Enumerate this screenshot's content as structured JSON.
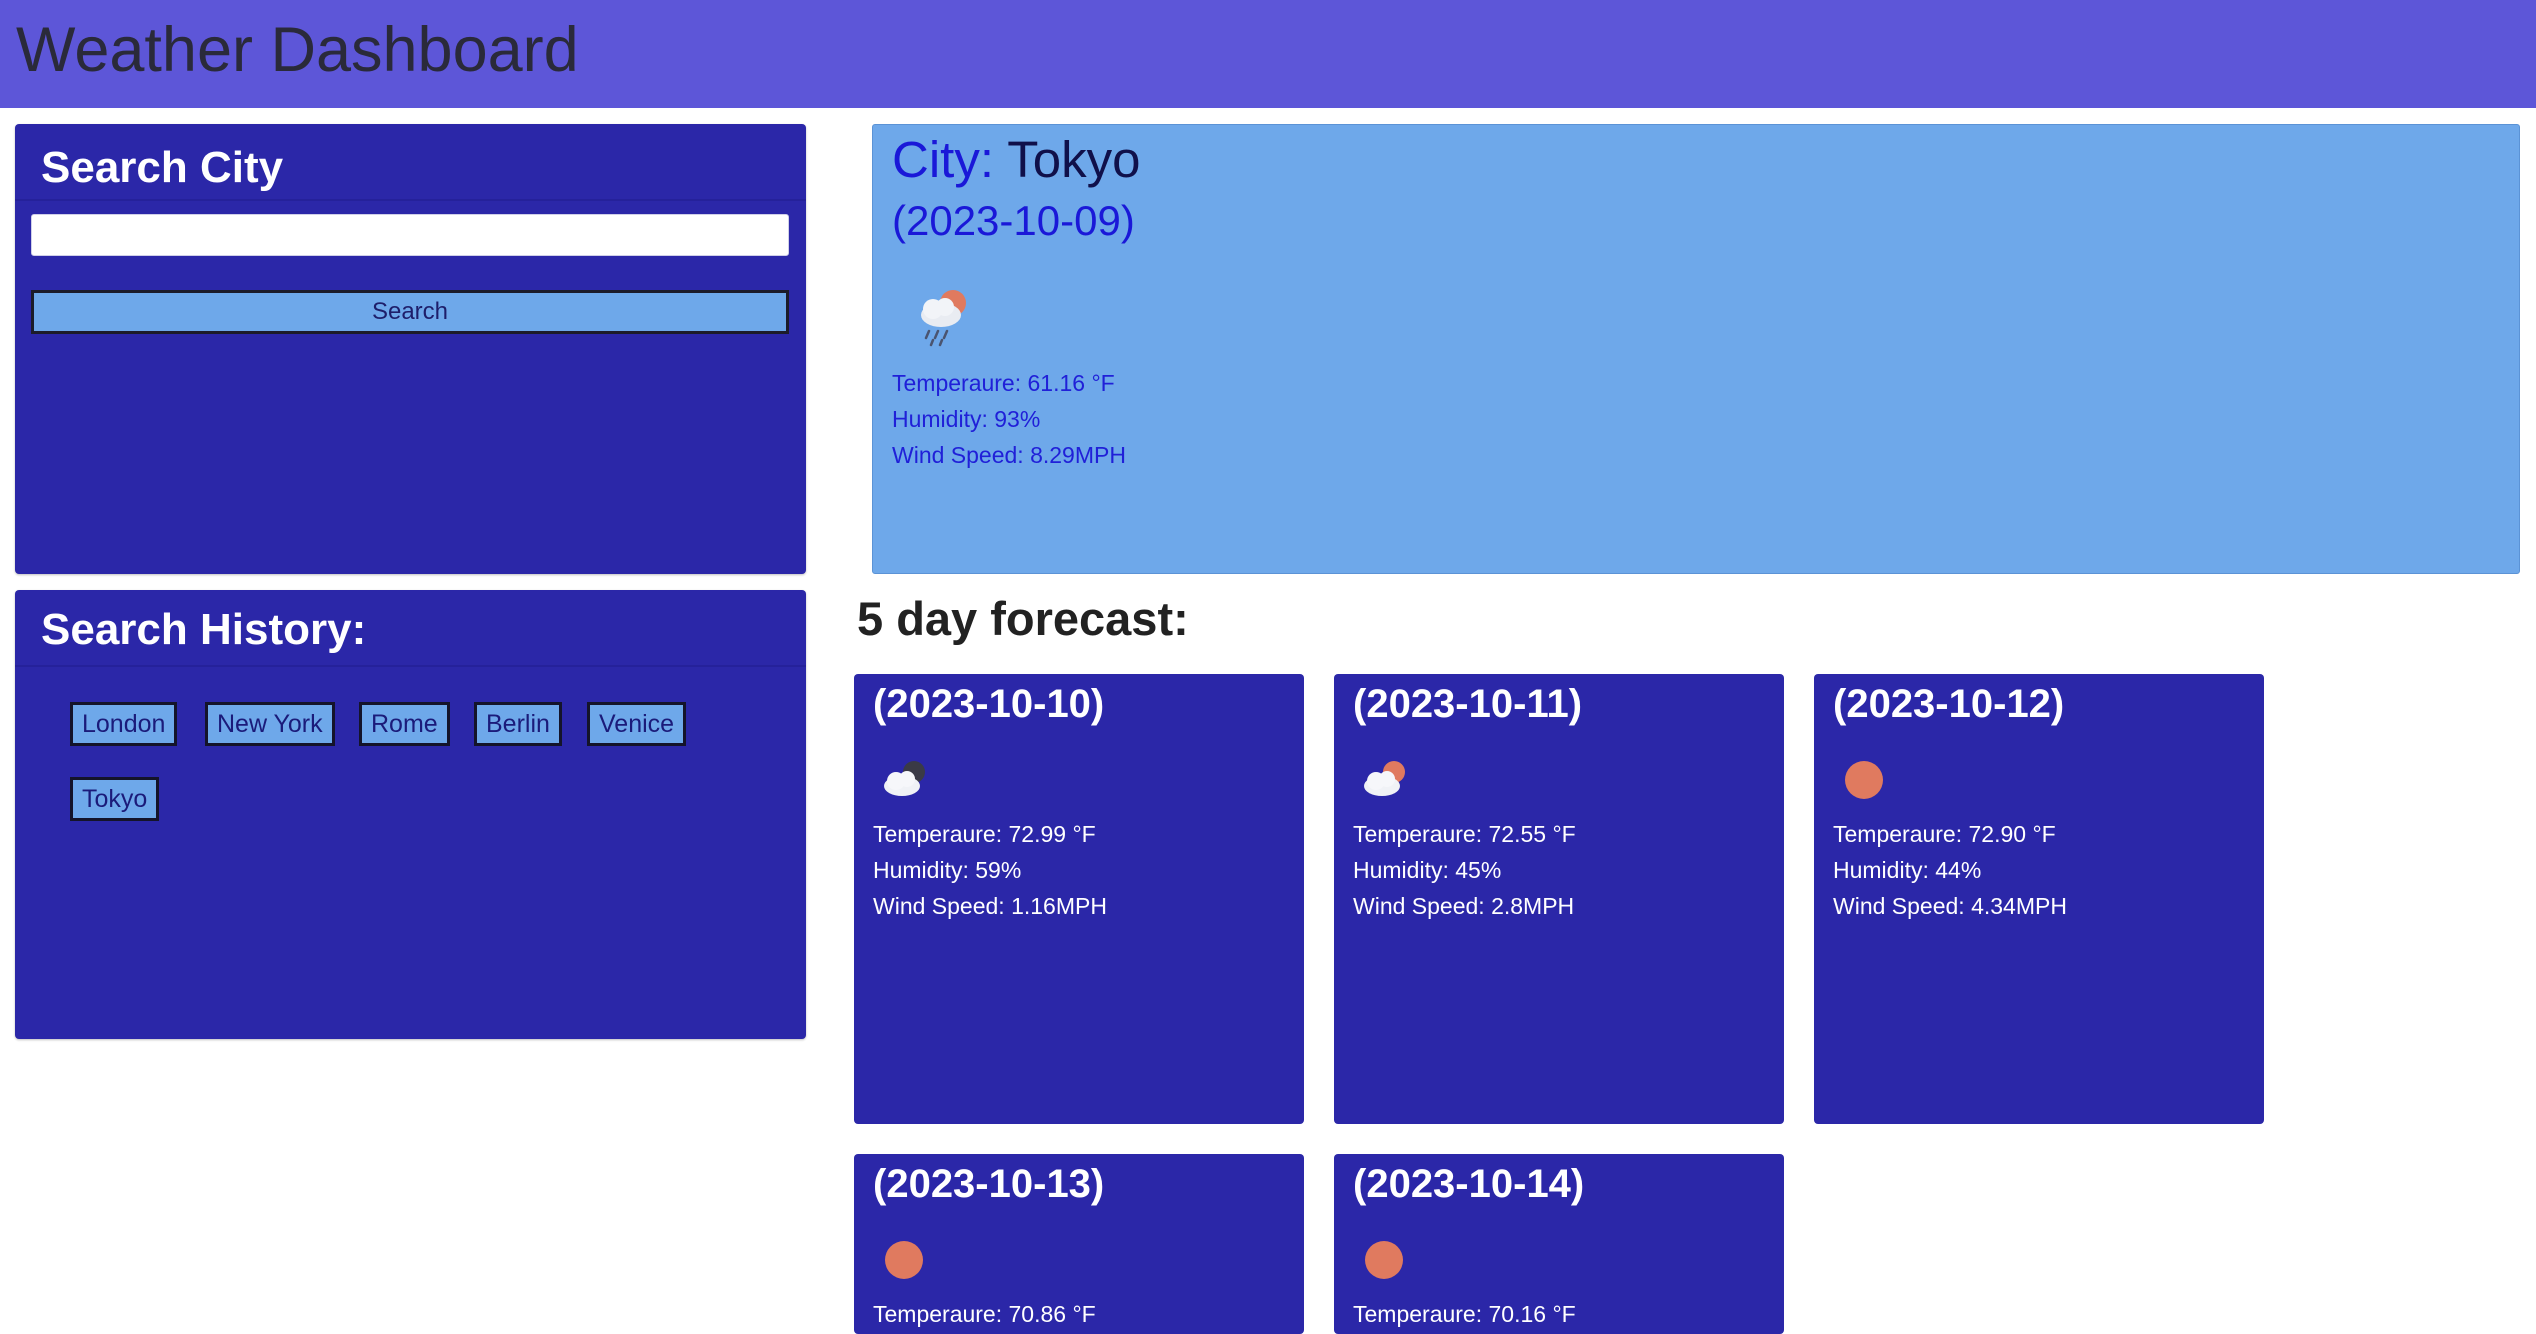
{
  "header": {
    "title": "Weather Dashboard"
  },
  "search": {
    "title": "Search City",
    "input_value": "",
    "placeholder": "",
    "button_label": "Search"
  },
  "history": {
    "title": "Search History:",
    "items": [
      "London",
      "New York",
      "Rome",
      "Berlin",
      "Venice",
      "Tokyo"
    ]
  },
  "current": {
    "city_prefix": "City:",
    "city": "Tokyo",
    "date": "(2023-10-09)",
    "icon": "rain-cloud-sun-icon",
    "temperature": "Temperaure: 61.16 °F",
    "humidity": "Humidity: 93%",
    "wind": "Wind Speed: 8.29MPH"
  },
  "forecast": {
    "heading": "5 day forecast:",
    "days": [
      {
        "date": "(2023-10-10)",
        "icon": "cloud-moon-icon",
        "temperature": "Temperaure: 72.99 °F",
        "humidity": "Humidity: 59%",
        "wind": "Wind Speed: 1.16MPH"
      },
      {
        "date": "(2023-10-11)",
        "icon": "cloud-sun-icon",
        "temperature": "Temperaure: 72.55 °F",
        "humidity": "Humidity: 45%",
        "wind": "Wind Speed: 2.8MPH"
      },
      {
        "date": "(2023-10-12)",
        "icon": "sun-icon",
        "temperature": "Temperaure: 72.90 °F",
        "humidity": "Humidity: 44%",
        "wind": "Wind Speed: 4.34MPH"
      },
      {
        "date": "(2023-10-13)",
        "icon": "sun-icon",
        "temperature": "Temperaure: 70.86 °F"
      },
      {
        "date": "(2023-10-14)",
        "icon": "sun-icon",
        "temperature": "Temperaure: 70.16 °F"
      }
    ]
  },
  "colors": {
    "header_bg": "#5d56d8",
    "panel_bg": "#2b27a8",
    "current_bg": "#6ea8ea",
    "accent_blue": "#1a18d8",
    "sun": "#e07a5f"
  }
}
